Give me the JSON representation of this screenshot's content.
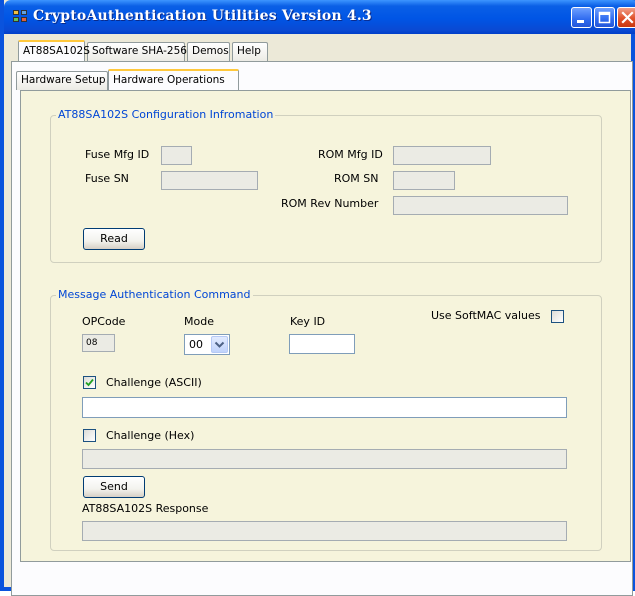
{
  "window": {
    "title": "CryptoAuthentication Utilities Version 4.3",
    "min_icon": "minimize-icon",
    "max_icon": "maximize-icon",
    "close_icon": "close-icon",
    "colors": {
      "titlebar": "#0055e5",
      "face": "#ece9d8",
      "panel": "#f6f4dc",
      "group_title": "#0046d5"
    }
  },
  "main_tabs": [
    {
      "label": "AT88SA102S",
      "selected": true
    },
    {
      "label": "Software SHA-256",
      "selected": false
    },
    {
      "label": "Demos",
      "selected": false
    },
    {
      "label": "Help",
      "selected": false
    }
  ],
  "sub_tabs": [
    {
      "label": "Hardware Setup",
      "selected": false
    },
    {
      "label": "Hardware Operations",
      "selected": true
    }
  ],
  "config_group": {
    "title": "AT88SA102S Configuration Infromation",
    "fuse_mfg_id_label": "Fuse Mfg ID",
    "fuse_mfg_id_value": "",
    "fuse_sn_label": "Fuse SN",
    "fuse_sn_value": "",
    "rom_mfg_id_label": "ROM Mfg ID",
    "rom_mfg_id_value": "",
    "rom_sn_label": "ROM SN",
    "rom_sn_value": "",
    "rom_rev_label": "ROM Rev Number",
    "rom_rev_value": "",
    "read_button": "Read"
  },
  "mac_group": {
    "title": "Message Authentication Command",
    "opcode_label": "OPCode",
    "opcode_value": "08",
    "mode_label": "Mode",
    "mode_value": "00",
    "key_id_label": "Key ID",
    "key_id_value": "",
    "softmac_label": "Use SoftMAC values",
    "softmac_checked": false,
    "challenge_ascii_label": "Challenge (ASCII)",
    "challenge_ascii_checked": true,
    "challenge_ascii_value": "",
    "challenge_hex_label": "Challenge (Hex)",
    "challenge_hex_checked": false,
    "challenge_hex_value": "",
    "send_button": "Send",
    "response_label": "AT88SA102S Response",
    "response_value": ""
  }
}
